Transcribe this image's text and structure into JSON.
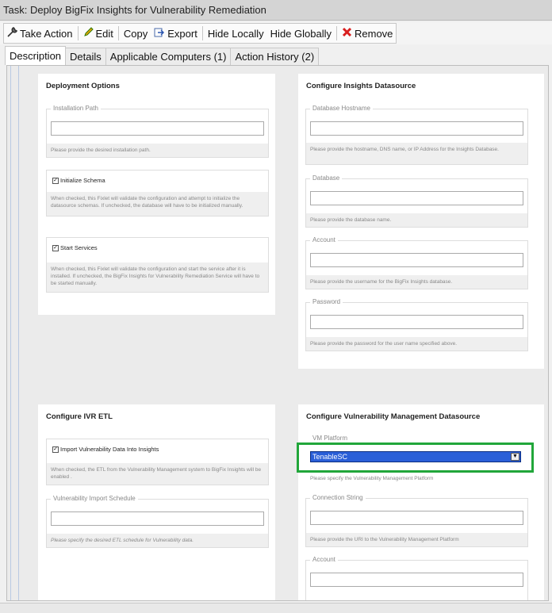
{
  "title": "Task: Deploy BigFix Insights for Vulnerability Remediation",
  "toolbar": {
    "take_action": "Take Action",
    "edit": "Edit",
    "copy": "Copy",
    "export": "Export",
    "hide_locally": "Hide Locally",
    "hide_globally": "Hide Globally",
    "remove": "Remove"
  },
  "tabs": {
    "description": "Description",
    "details": "Details",
    "applicable": "Applicable Computers (1)",
    "history": "Action History (2)"
  },
  "deployment": {
    "heading": "Deployment Options",
    "install_path_label": "Installation Path",
    "install_path_value": "",
    "install_path_desc": "Please provide the desired installation path.",
    "init_schema_label": "Initialize Schema",
    "init_schema_checked": true,
    "init_schema_desc": "When checked, this Fixlet will validate the configuration and attempt to initialize the datasource schemas. If unchecked, the database will have to be initialized manually.",
    "start_services_label": "Start Services",
    "start_services_checked": true,
    "start_services_desc": "When checked, this Fixlet will validate the configuration and start the service after it is installed. If unchecked, the BigFix Insights for Vulnerability Remediation Service will have to be started manually."
  },
  "insights": {
    "heading": "Configure Insights Datasource",
    "hostname_label": "Database Hostname",
    "hostname_desc": "Please provide the hostname, DNS name, or IP Address for the Insights Database.",
    "database_label": "Database",
    "database_desc": "Please provide the database name.",
    "account_label": "Account",
    "account_desc": "Please provide the username for the BigFix Insights database.",
    "password_label": "Password",
    "password_desc": "Please provide the password for the user name specified above."
  },
  "ivr": {
    "heading": "Configure IVR ETL",
    "import_label": "Import Vulnerability Data Into Insights",
    "import_checked": true,
    "import_desc": "When checked, the ETL from the Vulnerability Management system to BigFix Insights will be enabled .",
    "schedule_label": "Vulnerability Import Schedule",
    "schedule_desc": "Please specify the desired ETL schedule for Vulnerability data."
  },
  "vm": {
    "heading": "Configure Vulnerability Management Datasource",
    "platform_label": "VM Platform",
    "platform_value": "TenableSC",
    "platform_desc": "Please specify the Vulnerability Management Platform",
    "conn_label": "Connection String",
    "conn_desc": "Please provide the URI to the Vulnerability Management Platform",
    "account_label": "Account"
  },
  "colors": {
    "highlight": "#21a63a",
    "selected": "#2a5fd8"
  }
}
